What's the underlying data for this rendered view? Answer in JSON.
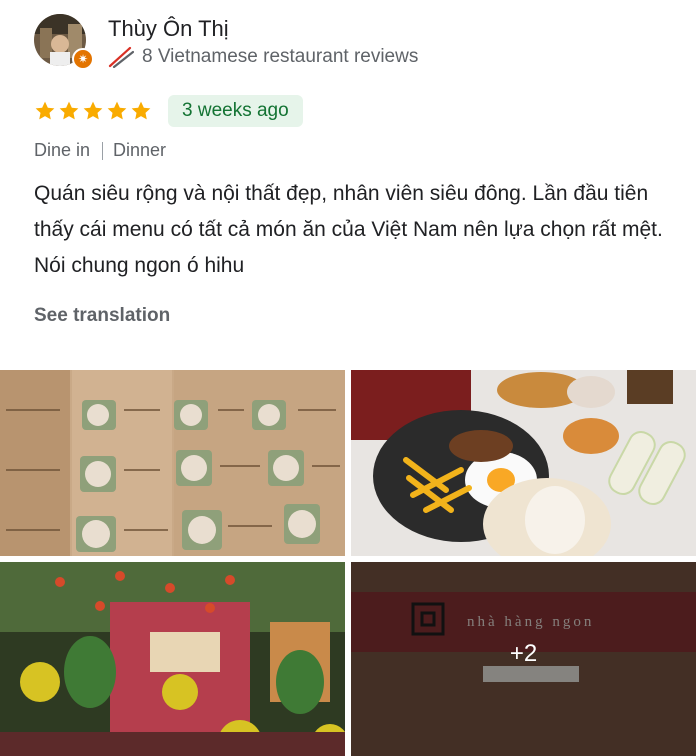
{
  "reviewer": {
    "name": "Thùy Ôn Thị",
    "review_count": "8 Vietnamese restaurant reviews",
    "avatar_icon": "profile-photo",
    "badge_icon": "local-guide-star-icon",
    "meta_icon": "chopsticks-icon"
  },
  "rating": {
    "stars": 5,
    "max": 5,
    "star_color": "#f9ab00",
    "time_ago": "3 weeks ago"
  },
  "dining": {
    "service": "Dine in",
    "meal": "Dinner"
  },
  "review": {
    "text": "Quán siêu rộng và nội thất đẹp, nhân viên siêu đông. Lần đầu tiên thấy cái menu có tất cả món ăn của Việt Nam nên lựa chọn rất mệt. Nói chung ngon ó hihu",
    "see_translation": "See translation"
  },
  "photos": {
    "items": [
      {
        "icon": "menu-photo"
      },
      {
        "icon": "food-plate-photo"
      },
      {
        "icon": "restaurant-interior-photo"
      },
      {
        "icon": "restaurant-sign-photo",
        "sign_text": "nhà hàng ngon",
        "more_label": "+2"
      }
    ]
  }
}
